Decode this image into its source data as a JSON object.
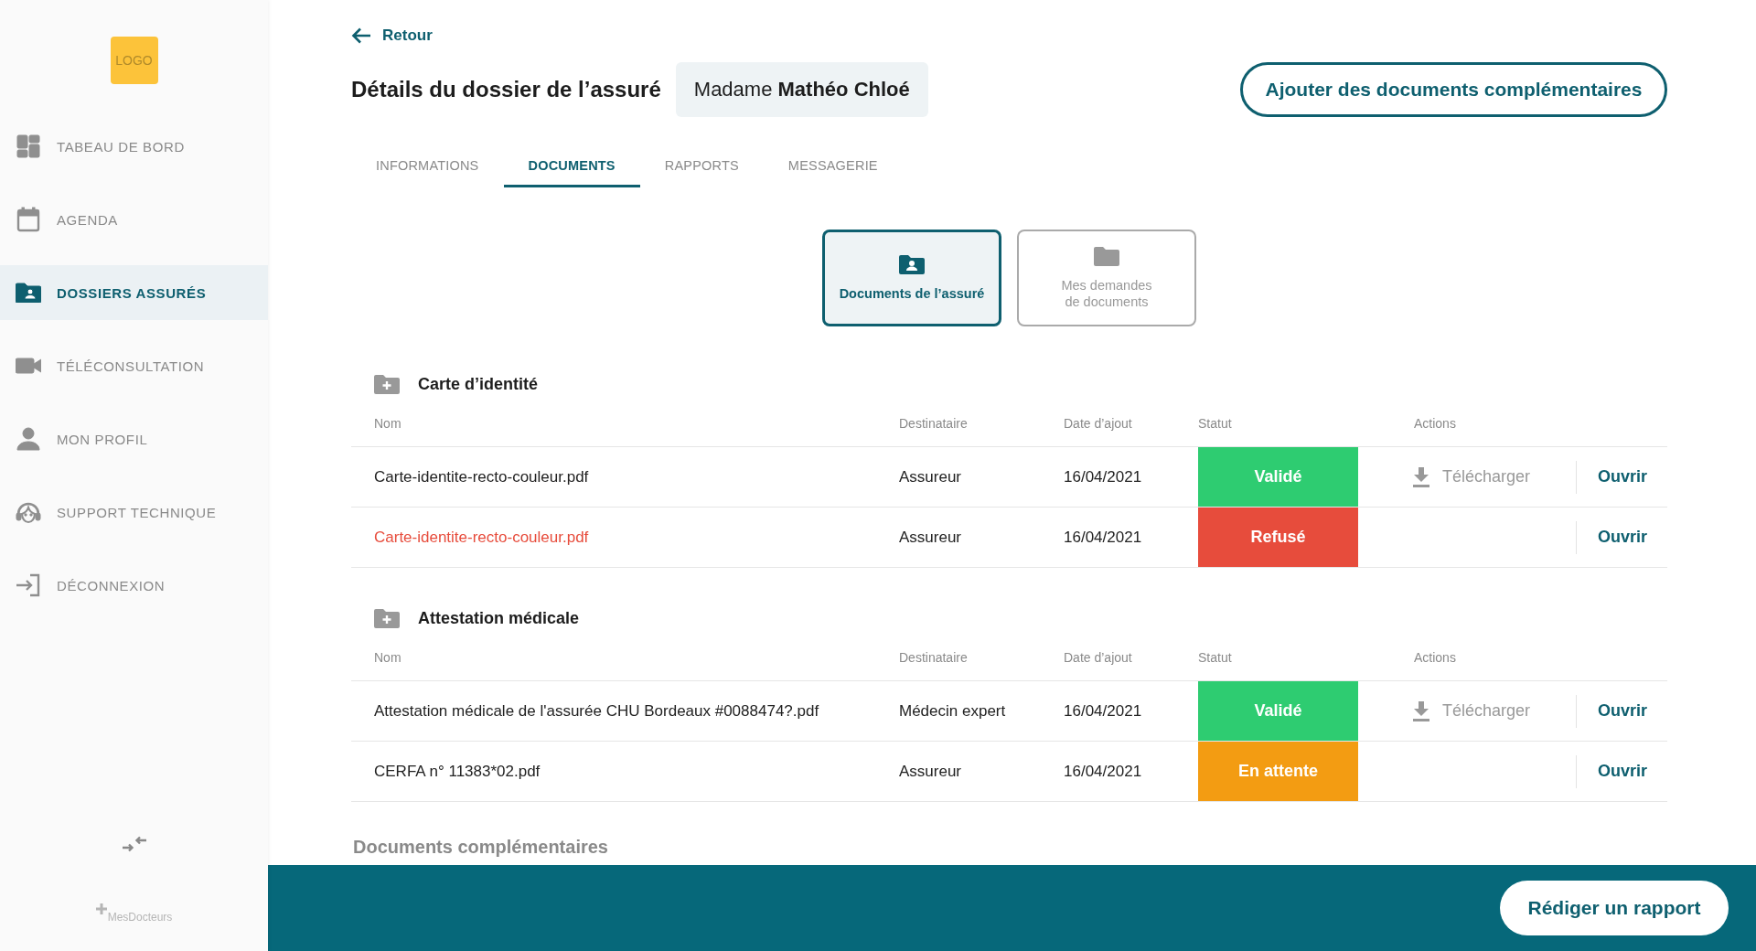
{
  "sidebar": {
    "logo": "LOGO",
    "items": [
      {
        "label": "TABEAU DE BORD",
        "selected": false
      },
      {
        "label": "AGENDA",
        "selected": false
      },
      {
        "label": "DOSSIERS ASSURÉS",
        "selected": true
      },
      {
        "label": "TÉLÉCONSULTATION",
        "selected": false
      },
      {
        "label": "MON PROFIL",
        "selected": false
      },
      {
        "label": "SUPPORT TECHNIQUE",
        "selected": false
      },
      {
        "label": "DÉCONNEXION",
        "selected": false
      }
    ],
    "brand": "MesDocteurs"
  },
  "header": {
    "back": "Retour",
    "title": "Détails du dossier de l’assuré",
    "insured": "Madame **Mathéo Chloé**",
    "action": "Ajouter des documents complémentaires"
  },
  "tabs": [
    {
      "label": "INFORMATIONS",
      "selected": false
    },
    {
      "label": "DOCUMENTS",
      "selected": true
    },
    {
      "label": "RAPPORTS",
      "selected": false
    },
    {
      "label": "MESSAGERIE",
      "selected": false
    }
  ],
  "doc_cards": [
    {
      "label": "Documents de l’assuré",
      "selected": true
    },
    {
      "label": "Mes demandes\nde documents",
      "selected": false
    }
  ],
  "sections": [
    {
      "title": "Carte d’identité",
      "columns": [
        "Nom",
        "Destinataire",
        "Date d’ajout",
        "Statut",
        "Actions"
      ],
      "rows": [
        {
          "name": "Carte-identite-recto-couleur.pdf",
          "flagged": false,
          "recipient": "Assureur",
          "date": "16/04/2021",
          "status": {
            "label": "Validé",
            "color": "#2ecc71"
          },
          "download": "Télécharger",
          "open": "Ouvrir"
        },
        {
          "name": "Carte-identite-recto-couleur.pdf",
          "flagged": true,
          "recipient": "Assureur",
          "date": "16/04/2021",
          "status": {
            "label": "Refusé",
            "color": "#e74c3c"
          },
          "open": "Ouvrir"
        }
      ]
    },
    {
      "title": "Attestation médicale",
      "columns": [
        "Nom",
        "Destinataire",
        "Date d’ajout",
        "Statut",
        "Actions"
      ],
      "rows": [
        {
          "name": "Attestation médicale de l'assurée CHU Bordeaux #0088474?.pdf",
          "flagged": false,
          "recipient": "Médecin expert",
          "date": "16/04/2021",
          "status": {
            "label": "Validé",
            "color": "#2ecc71"
          },
          "download": "Télécharger",
          "open": "Ouvrir"
        },
        {
          "name": "CERFA n° 11383*02.pdf",
          "flagged": false,
          "recipient": "Assureur",
          "date": "16/04/2021",
          "status": {
            "label": "En attente",
            "color": "#f39c12"
          },
          "open": "Ouvrir"
        }
      ]
    }
  ],
  "more_section": "Documents complémentaires",
  "footer": {
    "action": "Rédiger un rapport"
  }
}
